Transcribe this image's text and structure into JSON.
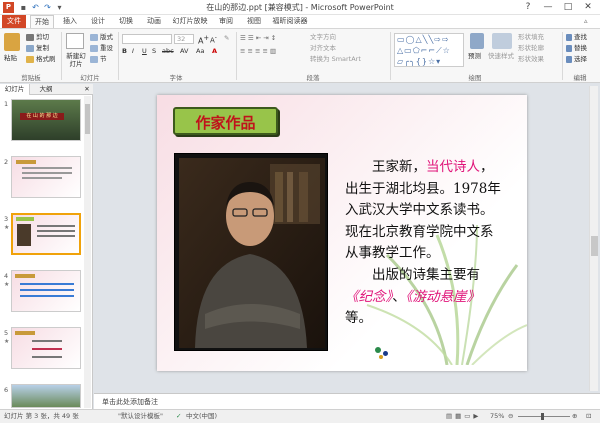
{
  "window": {
    "title": "在山的那边.ppt [兼容模式] - Microsoft PowerPoint",
    "controls": [
      "?",
      "—",
      "□",
      "✕"
    ]
  },
  "tabs": [
    "文件",
    "开始",
    "插入",
    "设计",
    "切换",
    "动画",
    "幻灯片放映",
    "审阅",
    "视图",
    "福昕阅读器"
  ],
  "ribbon": {
    "clipboard": {
      "paste": "粘贴",
      "cut": "剪切",
      "copy": "复制",
      "format_painter": "格式刷",
      "label": "剪贴板"
    },
    "slides": {
      "new_slide": "新建幻灯片",
      "layout": "版式",
      "reset": "重设",
      "section": "节",
      "label": "幻灯片"
    },
    "font": {
      "size": "32",
      "label": "字体",
      "buttons": [
        "B",
        "I",
        "U",
        "S",
        "abc",
        "AV",
        "Aa",
        "A"
      ]
    },
    "paragraph": {
      "text_direction": "文字方向",
      "align_text": "对齐文本",
      "smartart": "转换为 SmartArt",
      "label": "段落"
    },
    "drawing": {
      "arrange": "排列",
      "quick_styles": "快速样式",
      "shape_fill": "形状填充",
      "shape_outline": "形状轮廓",
      "shape_effects": "形状效果",
      "label": "绘图"
    },
    "editing": {
      "find": "查找",
      "replace": "替换",
      "select": "选择",
      "label": "编辑"
    },
    "misc": {
      "predict": "预测",
      "style": "快速样式"
    }
  },
  "left_pane": {
    "tabs": [
      "幻灯片",
      "大纲"
    ],
    "thumbs": [
      "1",
      "2",
      "3",
      "4",
      "5",
      "6"
    ],
    "thumb_title": "在 山 的 那 边"
  },
  "slide": {
    "badge": "作家作品",
    "paragraph1": {
      "line1_prefix": "王家新，",
      "line1_highlight": "当代诗人",
      "line1_suffix": "，",
      "line2": "出生于湖北均县。1978年",
      "line3": "入武汉大学中文系读书。",
      "line4": "现在北京教育学院中文系",
      "line5": "从事教学工作。"
    },
    "paragraph2": {
      "line1": "出版的诗集主要有",
      "work1": "《纪念》",
      "sep": "、",
      "work2": "《游动悬崖》",
      "line3": "等。"
    }
  },
  "notes_placeholder": "单击此处添加备注",
  "status": {
    "slide_info": "幻灯片 第 3 张，共 49 张",
    "theme": "\"默认设计模板\"",
    "language": "中文(中国)",
    "zoom": "75%"
  },
  "colors": {
    "file_tab": "#d24726",
    "highlight_text": "#e0157a",
    "badge_bg": "#98c44a",
    "badge_text": "#c0131b",
    "thumb_select": "#f0a20a"
  }
}
